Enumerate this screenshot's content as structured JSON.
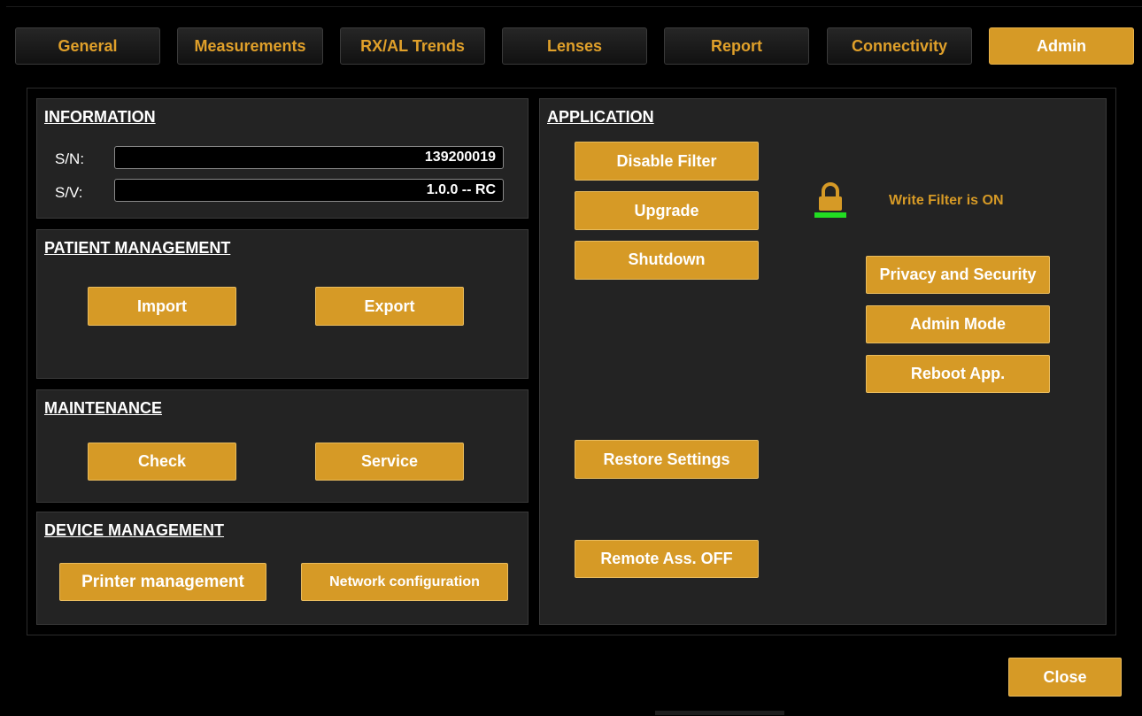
{
  "tabs": [
    {
      "label": "General",
      "active": false
    },
    {
      "label": "Measurements",
      "active": false
    },
    {
      "label": "RX/AL Trends",
      "active": false
    },
    {
      "label": "Lenses",
      "active": false
    },
    {
      "label": "Report",
      "active": false
    },
    {
      "label": "Connectivity",
      "active": false
    },
    {
      "label": "Admin",
      "active": true
    }
  ],
  "information": {
    "title": "INFORMATION",
    "sn_label": "S/N:",
    "sn_value": "139200019",
    "sv_label": "S/V:",
    "sv_value": "1.0.0 -- RC"
  },
  "patient_management": {
    "title": "PATIENT MANAGEMENT",
    "import_label": "Import",
    "export_label": "Export"
  },
  "maintenance": {
    "title": "MAINTENANCE",
    "check_label": "Check",
    "service_label": "Service"
  },
  "device_management": {
    "title": "DEVICE MANAGEMENT",
    "printer_label": "Printer management",
    "network_label": "Network configuration"
  },
  "application": {
    "title": "APPLICATION",
    "disable_filter_label": "Disable Filter",
    "upgrade_label": "Upgrade",
    "shutdown_label": "Shutdown",
    "write_filter_status": "Write Filter is ON",
    "privacy_label": "Privacy and Security",
    "admin_mode_label": "Admin Mode",
    "reboot_label": "Reboot App.",
    "restore_label": "Restore Settings",
    "remote_label": "Remote Ass. OFF"
  },
  "close_label": "Close",
  "icons": {
    "lock": "lock-icon",
    "status_bar": "write-filter-status-bar"
  },
  "colors": {
    "accent": "#d69a26",
    "status_on": "#22dd22",
    "background": "#000000",
    "panel": "#232323"
  }
}
